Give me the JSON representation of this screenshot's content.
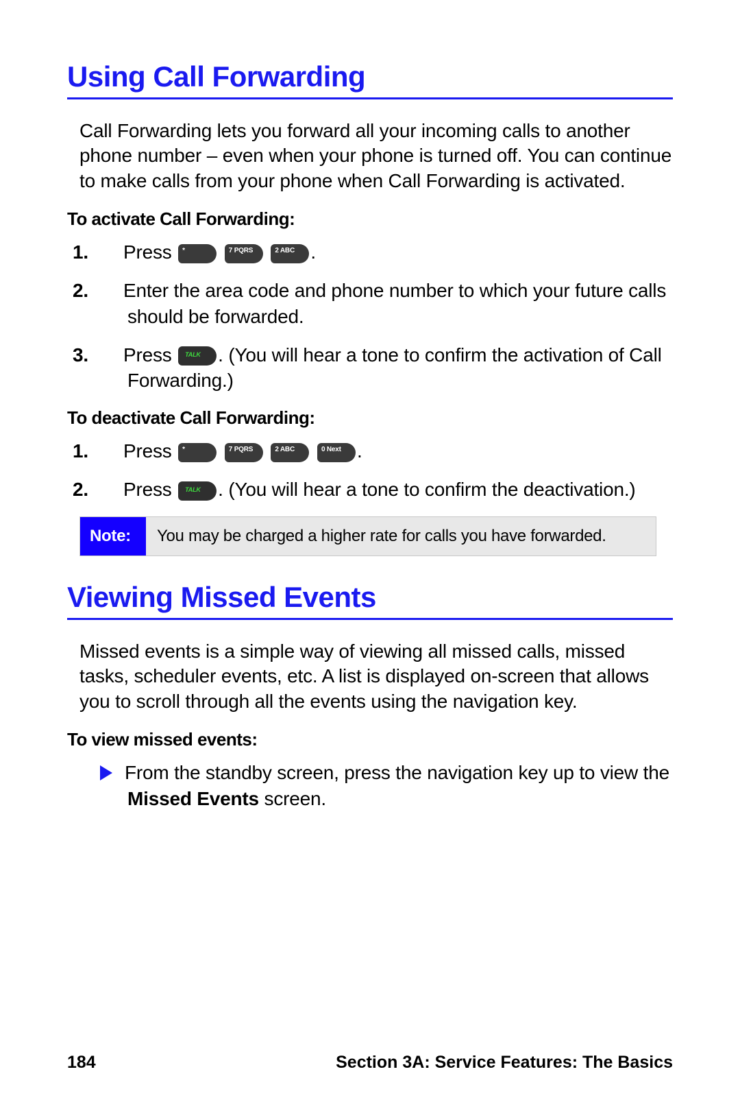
{
  "section1": {
    "title": "Using Call Forwarding",
    "intro": "Call Forwarding lets you forward all your incoming calls to another phone number – even when your phone is turned off. You can continue to make calls from your phone when Call Forwarding is activated.",
    "activate_head": "To activate Call Forwarding:",
    "activate_steps": {
      "s1_press": "Press ",
      "s1_keys": [
        "*",
        "7 PQRS",
        "2 ABC"
      ],
      "s1_end": ".",
      "s2": "Enter the area code and phone number to which your future calls should be forwarded.",
      "s3_press": "Press ",
      "s3_key": "TALK",
      "s3_rest": ". (You will hear a tone to confirm the activation of Call Forwarding.)"
    },
    "deactivate_head": "To deactivate Call Forwarding:",
    "deactivate_steps": {
      "s1_press": "Press ",
      "s1_keys": [
        "*",
        "7 PQRS",
        "2 ABC",
        "0 Next"
      ],
      "s1_end": ".",
      "s2_press": "Press ",
      "s2_key": "TALK",
      "s2_rest": ". (You will hear a tone to confirm the deactivation.)"
    },
    "note_label": "Note:",
    "note_text": "You may be charged a higher rate for calls you have forwarded."
  },
  "section2": {
    "title": "Viewing Missed Events",
    "intro": "Missed events is a simple way of viewing all missed calls, missed tasks, scheduler events, etc. A list is displayed on-screen that allows you to scroll through all the events using the navigation key.",
    "view_head": "To view missed events:",
    "bullet_pre": "From the standby screen, press the navigation key up to view the ",
    "bullet_bold": "Missed Events",
    "bullet_post": " screen."
  },
  "footer": {
    "page": "184",
    "section": "Section 3A: Service Features: The Basics"
  },
  "nums": {
    "n1": "1.",
    "n2": "2.",
    "n3": "3."
  }
}
